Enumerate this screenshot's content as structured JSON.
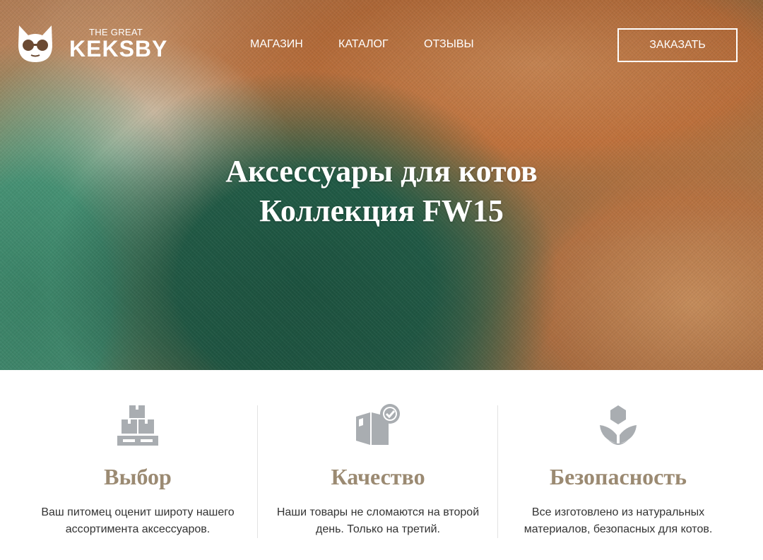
{
  "logo": {
    "small_text": "THE GREAT",
    "brand": "KEKSBY"
  },
  "nav": {
    "items": [
      "МАГАЗИН",
      "КАТАЛОГ",
      "ОТЗЫВЫ"
    ]
  },
  "header": {
    "order_label": "ЗАКАЗАТЬ"
  },
  "hero": {
    "title_line1": "Аксессуары для котов",
    "title_line2": "Коллекция FW15"
  },
  "features": [
    {
      "icon": "boxes-pallet-icon",
      "title": "Выбор",
      "text": "Ваш питомец оценит широту нашего ассортимента аксессуаров."
    },
    {
      "icon": "box-checkmark-icon",
      "title": "Качество",
      "text": "Наши товары не сломаются на второй день. Только на третий."
    },
    {
      "icon": "plant-sprout-icon",
      "title": "Безопасность",
      "text": "Все изготовлено из натуральных материалов, безопасных для котов."
    }
  ],
  "colors": {
    "accent_title": "#9b8a72",
    "icon_gray": "#a9adb1",
    "text": "#333333"
  }
}
